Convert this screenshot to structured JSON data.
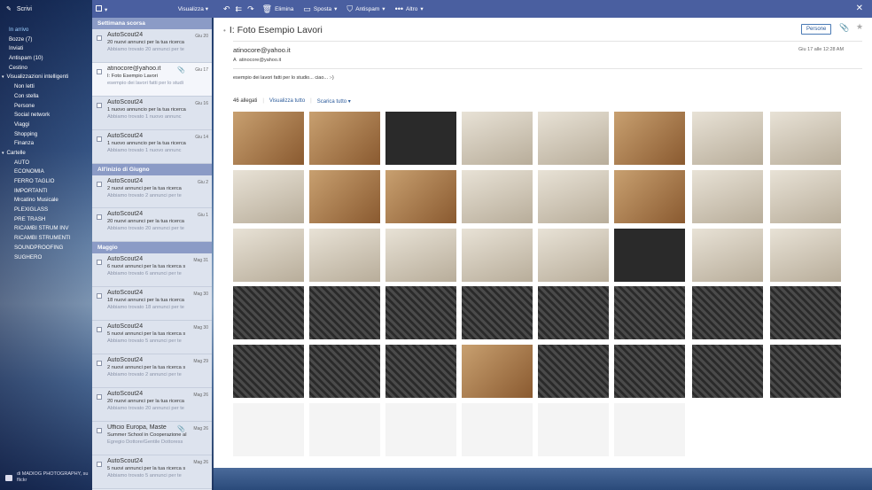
{
  "toolbar": {
    "compose": "Scrivi",
    "view": "Visualizza",
    "delete": "Elimina",
    "move": "Sposta",
    "spam": "Antispam",
    "more": "Altro"
  },
  "nav": {
    "items": [
      {
        "label": "In arrivo",
        "level": 0,
        "color": "#9ed0ff"
      },
      {
        "label": "Bozze (7)",
        "level": 0
      },
      {
        "label": "Inviati",
        "level": 0
      },
      {
        "label": "Antispam (10)",
        "level": 0
      },
      {
        "label": "Cestino",
        "level": 0
      },
      {
        "label": "Visualizzazioni intelligenti",
        "level": 0,
        "section": true
      },
      {
        "label": "Non letti",
        "level": 1
      },
      {
        "label": "Con stella",
        "level": 1
      },
      {
        "label": "Persone",
        "level": 1
      },
      {
        "label": "Social network",
        "level": 1
      },
      {
        "label": "Viaggi",
        "level": 1
      },
      {
        "label": "Shopping",
        "level": 1
      },
      {
        "label": "Finanza",
        "level": 1
      },
      {
        "label": "Cartelle",
        "level": 0,
        "section": true
      },
      {
        "label": "AUTO",
        "level": 1
      },
      {
        "label": "ECONOMIA",
        "level": 1
      },
      {
        "label": "FERRO TAGLIO",
        "level": 1
      },
      {
        "label": "IMPORTANTI",
        "level": 1
      },
      {
        "label": "Mrcatino Musicale",
        "level": 1
      },
      {
        "label": "PLEXIGLASS",
        "level": 1
      },
      {
        "label": "PRE TRASH",
        "level": 1
      },
      {
        "label": "RICAMBI STRUM INV",
        "level": 1
      },
      {
        "label": "RICAMBI STRUMENTI",
        "level": 1
      },
      {
        "label": "SOUNDPROOFING",
        "level": 1
      },
      {
        "label": "SUGHERO",
        "level": 1
      }
    ],
    "credit": "di MADIOG PHOTOGRAPHY, su flickr"
  },
  "list": {
    "groups": [
      {
        "title": "Settimana scorsa",
        "messages": [
          {
            "from": "AutoScout24",
            "date": "Giu 20",
            "subject": "20 nuovi annunci per la tua ricerca",
            "preview": "Abbiamo trovato 20 annunci per te"
          },
          {
            "from": "atinocore@yahoo.it",
            "date": "Giu 17",
            "subject": "I: Foto Esempio Lavori",
            "preview": "esempio dei lavori fatti per lo studi",
            "selected": true,
            "attachment": true
          },
          {
            "from": "AutoScout24",
            "date": "Giu 16",
            "subject": "1 nuovo annuncio per la tua ricerca",
            "preview": "Abbiamo trovato 1 nuovo annunc"
          },
          {
            "from": "AutoScout24",
            "date": "Giu 14",
            "subject": "1 nuovo annuncio per la tua ricerca",
            "preview": "Abbiamo trovato 1 nuovo annunc"
          }
        ]
      },
      {
        "title": "All'inizio di Giugno",
        "messages": [
          {
            "from": "AutoScout24",
            "date": "Giu 2",
            "subject": "2 nuovi annunci per la tua ricerca",
            "preview": "Abbiamo trovato 2 annunci per te"
          },
          {
            "from": "AutoScout24",
            "date": "Giu 1",
            "subject": "20 nuovi annunci per la tua ricerca",
            "preview": "Abbiamo trovato 20 annunci per te"
          }
        ]
      },
      {
        "title": "Maggio",
        "messages": [
          {
            "from": "AutoScout24",
            "date": "Mag 31",
            "subject": "6 nuovi annunci per la tua ricerca s",
            "preview": "Abbiamo trovato 6 annunci per te"
          },
          {
            "from": "AutoScout24",
            "date": "Mag 30",
            "subject": "18 nuovi annunci per la tua ricerca",
            "preview": "Abbiamo trovato 18 annunci per te"
          },
          {
            "from": "AutoScout24",
            "date": "Mag 30",
            "subject": "5 nuovi annunci per la tua ricerca s",
            "preview": "Abbiamo trovato 5 annunci per te"
          },
          {
            "from": "AutoScout24",
            "date": "Mag 29",
            "subject": "2 nuovi annunci per la tua ricerca s",
            "preview": "Abbiamo trovato 2 annunci per te"
          },
          {
            "from": "AutoScout24",
            "date": "Mag 26",
            "subject": "20 nuovi annunci per la tua ricerca",
            "preview": "Abbiamo trovato 20 annunci per te"
          },
          {
            "from": "Ufficio Europa, Maste",
            "date": "Mag 26",
            "subject": "Summer School in Cooperazione al",
            "preview": "Egregio Dottore/Gentile Dottoress",
            "attachment": true
          },
          {
            "from": "AutoScout24",
            "date": "Mag 26",
            "subject": "5 nuovi annunci per la tua ricerca s",
            "preview": "Abbiamo trovato 5 annunci per te"
          }
        ]
      }
    ]
  },
  "reader": {
    "title": "I: Foto Esempio Lavori",
    "persone": "Persone",
    "sender": "atinocore@yahoo.it",
    "to_prefix": "A",
    "to": "atinocore@yahoo.it",
    "date": "Giu 17 alle 12:28 AM",
    "body": "esempio dei lavori fatti per lo studio... ciao... :-)",
    "attachments_count": "46 allegati",
    "view_all": "Visualizza tutto",
    "download_all": "Scarica tutto"
  },
  "thumbs": [
    [
      "wood",
      "wood",
      "dark",
      "cream",
      "cream",
      "wood",
      "cream",
      "cream"
    ],
    [
      "cream",
      "wood",
      "wood",
      "cream",
      "cream",
      "wood",
      "cream",
      "cream"
    ],
    [
      "cream",
      "cream",
      "cream",
      "cream",
      "cream",
      "dark",
      "cream",
      "cream"
    ],
    [
      "foam",
      "foam",
      "foam",
      "foam",
      "foam",
      "foam",
      "foam",
      "foam"
    ],
    [
      "foam",
      "foam",
      "foam",
      "wood",
      "foam",
      "foam",
      "foam",
      "foam"
    ],
    [
      "plot",
      "plot",
      "plot",
      "plot",
      "plot",
      "plot"
    ]
  ]
}
